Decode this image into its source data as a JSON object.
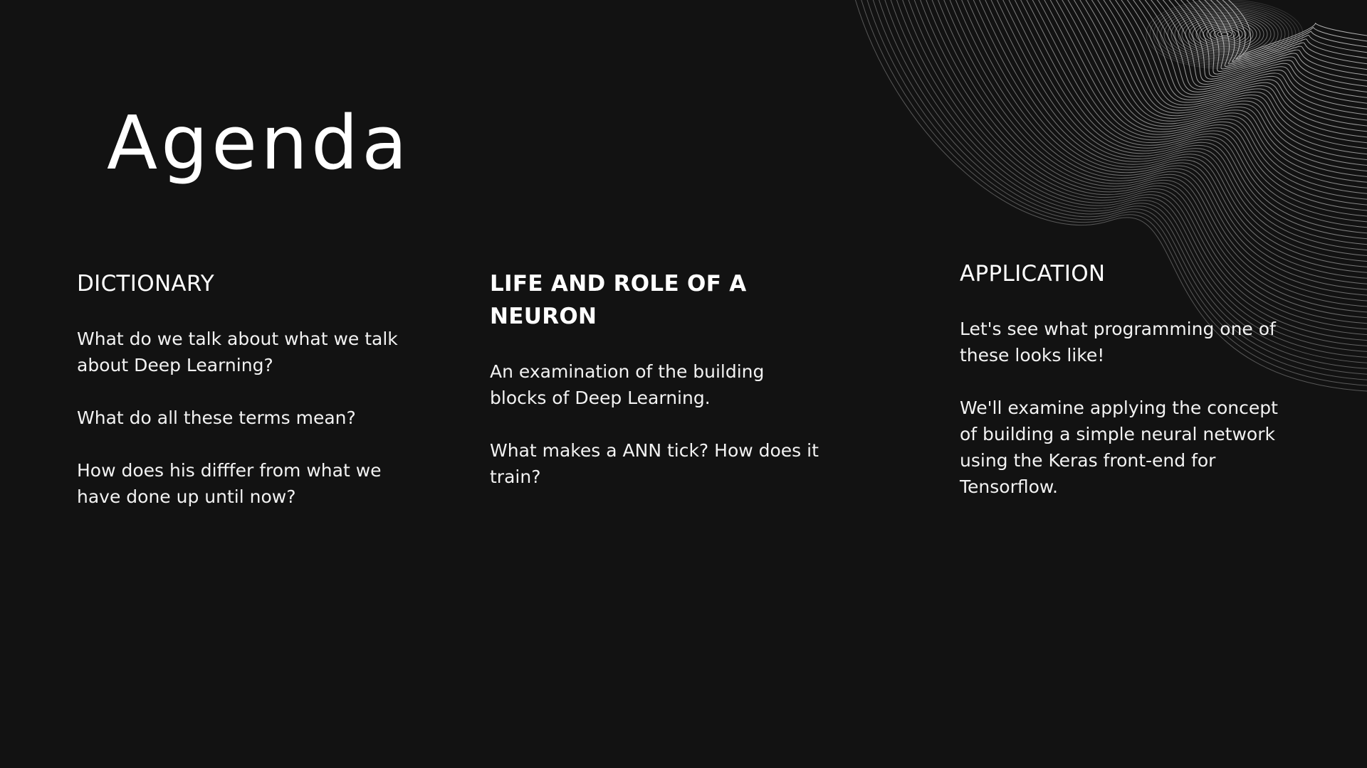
{
  "slide": {
    "title": "Agenda",
    "columns": [
      {
        "heading": "DICTIONARY",
        "paragraphs": [
          "What do we talk about what we talk about Deep Learning?",
          "What do all these terms mean?",
          "How does his difffer from what we have done up until now?"
        ]
      },
      {
        "heading": "LIFE AND ROLE OF A NEURON",
        "paragraphs": [
          "An examination of the building blocks of Deep Learning.",
          "What makes a ANN tick? How does it train?"
        ]
      },
      {
        "heading": "APPLICATION",
        "paragraphs": [
          "Let's see what programming one of these looks like!",
          "We'll examine applying the concept of building a simple neural network using the Keras front-end for Tensorflow."
        ]
      }
    ]
  },
  "colors": {
    "background": "#121212",
    "text": "#ffffff",
    "decor_lines": "#d9d9d9"
  },
  "decor": {
    "icon": "contour-wave-lines"
  }
}
